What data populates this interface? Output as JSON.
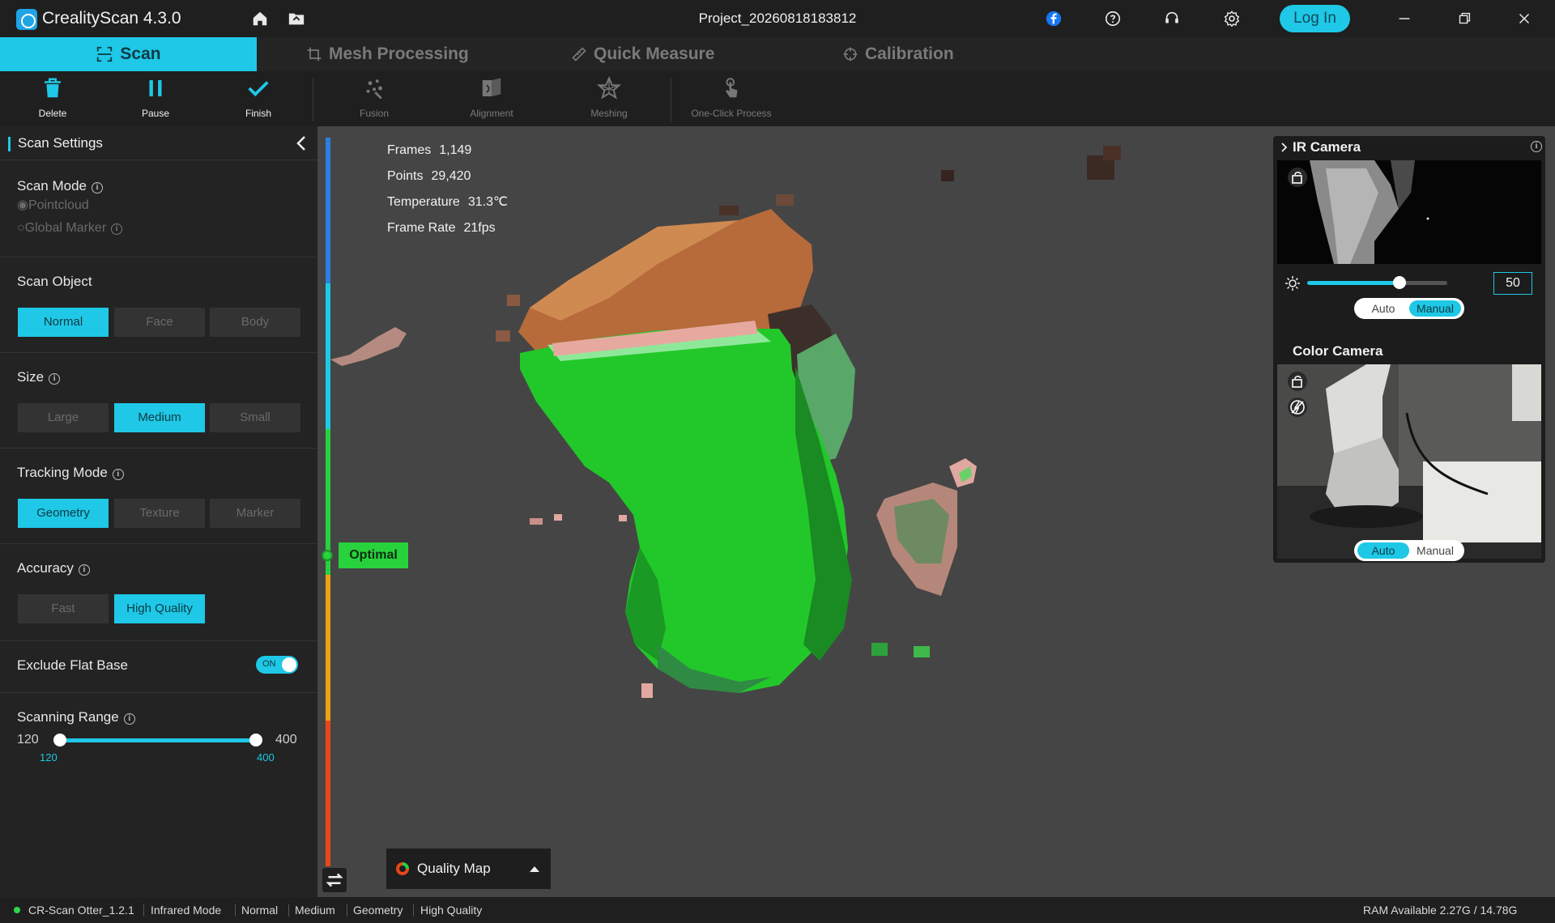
{
  "titlebar": {
    "app_title": "CrealityScan 4.3.0",
    "project_name": "Project_20260818183812",
    "login_label": "Log In"
  },
  "tabs": [
    {
      "label": "Scan",
      "icon": "scan-frame-icon"
    },
    {
      "label": "Mesh Processing",
      "icon": "crop-icon"
    },
    {
      "label": "Quick Measure",
      "icon": "ruler-icon"
    },
    {
      "label": "Calibration",
      "icon": "crosshair-icon"
    }
  ],
  "toolbar": {
    "delete": "Delete",
    "pause": "Pause",
    "finish": "Finish",
    "fusion": "Fusion",
    "alignment": "Alignment",
    "meshing": "Meshing",
    "one_click": "One-Click Process"
  },
  "sidebar": {
    "title": "Scan Settings",
    "scan_mode": {
      "title": "Scan Mode",
      "option1": "Pointcloud",
      "option2": "Global Marker"
    },
    "scan_object": {
      "title": "Scan Object",
      "options": [
        "Normal",
        "Face",
        "Body"
      ],
      "selected": "Normal"
    },
    "size": {
      "title": "Size",
      "options": [
        "Large",
        "Medium",
        "Small"
      ],
      "selected": "Medium"
    },
    "tracking_mode": {
      "title": "Tracking Mode",
      "options": [
        "Geometry",
        "Texture",
        "Marker"
      ],
      "selected": "Geometry"
    },
    "accuracy": {
      "title": "Accuracy",
      "options": [
        "Fast",
        "High Quality"
      ],
      "selected": "High Quality"
    },
    "exclude_flat_base": {
      "title": "Exclude Flat Base",
      "state": "ON"
    },
    "scanning_range": {
      "title": "Scanning Range",
      "min": "120",
      "max": "400",
      "low": "120",
      "high": "400"
    }
  },
  "viewport": {
    "stats": [
      {
        "label": "Frames",
        "value": "1,149"
      },
      {
        "label": "Points",
        "value": "29,420"
      },
      {
        "label": "Temperature",
        "value": "31.3℃"
      },
      {
        "label": "Frame Rate",
        "value": "21fps"
      }
    ],
    "distance_indicator": "Optimal",
    "quality_map_label": "Quality Map"
  },
  "cameras": {
    "ir_title": "IR Camera",
    "ir_brightness": "50",
    "ir_mode": {
      "auto": "Auto",
      "manual": "Manual",
      "selected": "Manual"
    },
    "color_title": "Color Camera",
    "color_mode": {
      "auto": "Auto",
      "manual": "Manual",
      "selected": "Auto"
    }
  },
  "statusbar": {
    "items": [
      "CR-Scan Otter_1.2.1",
      "Infrared Mode",
      "Normal",
      "Medium",
      "Geometry",
      "High Quality"
    ],
    "ram": "RAM Available 2.27G / 14.78G"
  },
  "colors": {
    "accent": "#1ec8e6",
    "optimal": "#28d23c",
    "scan_green": "#22c82a"
  }
}
